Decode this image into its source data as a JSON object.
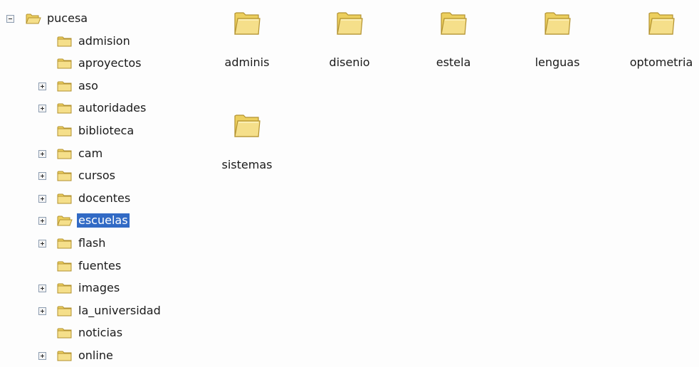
{
  "tree": {
    "root": {
      "label": "pucesa",
      "icon": "folder-open-icon",
      "expander": "minus"
    },
    "items": [
      {
        "label": "admision",
        "expander": "none",
        "selected": false
      },
      {
        "label": "aproyectos",
        "expander": "none",
        "selected": false
      },
      {
        "label": "aso",
        "expander": "plus",
        "selected": false
      },
      {
        "label": "autoridades",
        "expander": "plus",
        "selected": false
      },
      {
        "label": "biblioteca",
        "expander": "none",
        "selected": false
      },
      {
        "label": "cam",
        "expander": "plus",
        "selected": false
      },
      {
        "label": "cursos",
        "expander": "plus",
        "selected": false
      },
      {
        "label": "docentes",
        "expander": "plus",
        "selected": false
      },
      {
        "label": "escuelas",
        "expander": "plus",
        "selected": true
      },
      {
        "label": "flash",
        "expander": "plus",
        "selected": false
      },
      {
        "label": "fuentes",
        "expander": "none",
        "selected": false
      },
      {
        "label": "images",
        "expander": "plus",
        "selected": false
      },
      {
        "label": "la_universidad",
        "expander": "plus",
        "selected": false
      },
      {
        "label": "noticias",
        "expander": "none",
        "selected": false
      },
      {
        "label": "online",
        "expander": "plus",
        "selected": false
      }
    ]
  },
  "content": {
    "items": [
      {
        "label": "adminis",
        "icon": "folder-icon"
      },
      {
        "label": "disenio",
        "icon": "folder-icon"
      },
      {
        "label": "estela",
        "icon": "folder-icon"
      },
      {
        "label": "lenguas",
        "icon": "folder-icon"
      },
      {
        "label": "optometria",
        "icon": "folder-icon"
      },
      {
        "label": "sistemas",
        "icon": "folder-icon"
      }
    ]
  },
  "colors": {
    "folder_fill": "#f5df8a",
    "folder_tab": "#eccf5e",
    "folder_stroke": "#b39230",
    "selection": "#316ac5"
  }
}
